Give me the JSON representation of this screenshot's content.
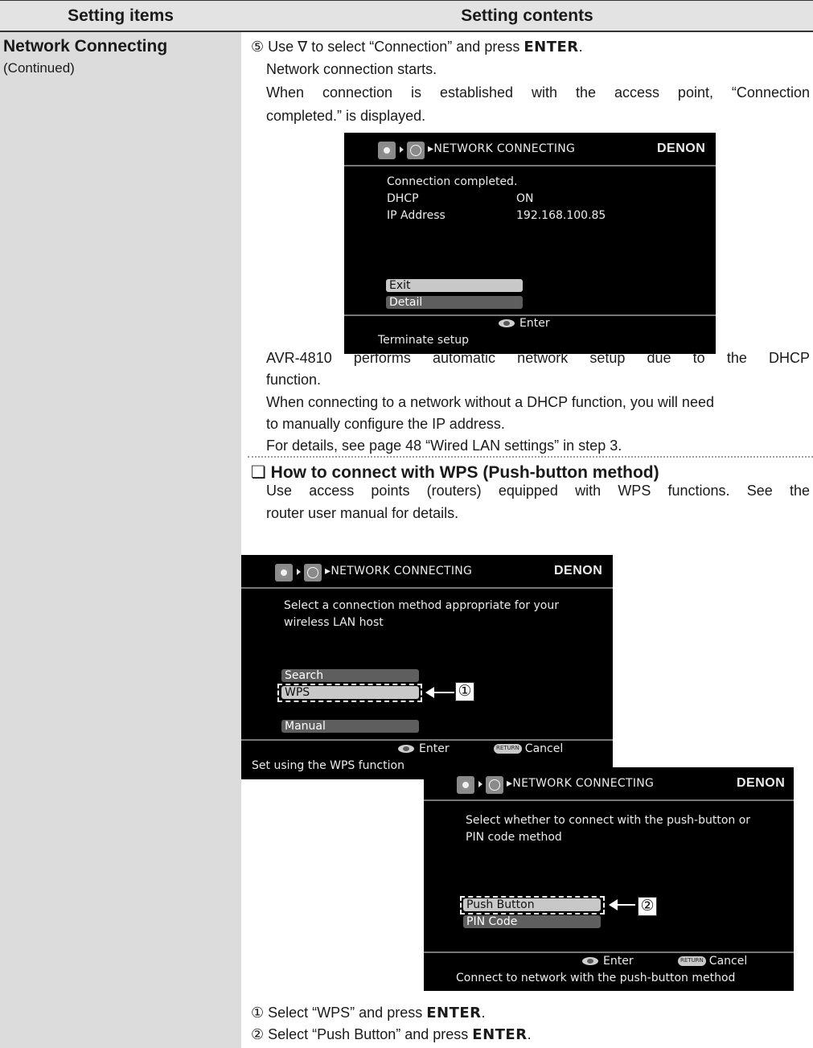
{
  "header": {
    "left": "Setting items",
    "right": "Setting contents"
  },
  "item": {
    "title": "Network Connecting",
    "subtitle": "(Continued)"
  },
  "step5": {
    "num": "⑤",
    "pre": " Use ∇ to select “Connection” and press ",
    "enter": "ENTER",
    "post": ".",
    "l2": "Network connection starts.",
    "l3": "When connection is established with the access point, “Connection",
    "l4": "completed.” is displayed."
  },
  "screen1": {
    "breadcrumb": "▸NETWORK CONNECTING",
    "brand": "DENON",
    "lines": [
      "Connection completed."
    ],
    "rows": [
      {
        "label": "DHCP",
        "value": "ON"
      },
      {
        "label": "IP Address",
        "value": "192.168.100.85"
      }
    ],
    "buttons": [
      "Exit",
      "Detail"
    ],
    "enter": "Enter",
    "status": "Terminate setup"
  },
  "para": {
    "l1": "AVR-4810 performs automatic network setup due to the DHCP",
    "l2": "function.",
    "l3": "When connecting to a network without a DHCP function, you will need",
    "l4": "to manually configure the IP address.",
    "l5": "For details, see page 48 “Wired LAN settings” in step 3."
  },
  "wps": {
    "checkbox": "❏",
    "heading": "How to connect with WPS (Push-button method)",
    "l1": "Use access points (routers) equipped with WPS functions. See the",
    "l2": "router user manual for details."
  },
  "screen2": {
    "breadcrumb": "▸NETWORK CONNECTING",
    "brand": "DENON",
    "l1": "Select a connection method appropriate for your",
    "l2": "wireless LAN host",
    "buttons": [
      "Search",
      "WPS",
      "Manual"
    ],
    "enter": "Enter",
    "return_icon": "RETURN",
    "cancel": "Cancel",
    "status": "Set using the WPS function"
  },
  "screen3": {
    "breadcrumb": "▸NETWORK CONNECTING",
    "brand": "DENON",
    "l1": "Select whether to connect with the push-button or",
    "l2": "PIN code method",
    "buttons": [
      "Push Button",
      "PIN Code"
    ],
    "enter": "Enter",
    "return_icon": "RETURN",
    "cancel": "Cancel",
    "status": "Connect to network with the push-button method"
  },
  "callouts": {
    "c1": "①",
    "c2": "②"
  },
  "steps": {
    "s1": {
      "num": "①",
      "pre": " Select “WPS” and press ",
      "enter": "ENTER",
      "post": "."
    },
    "s2": {
      "num": "②",
      "pre": " Select “Push Button” and press ",
      "enter": "ENTER",
      "post": "."
    }
  }
}
